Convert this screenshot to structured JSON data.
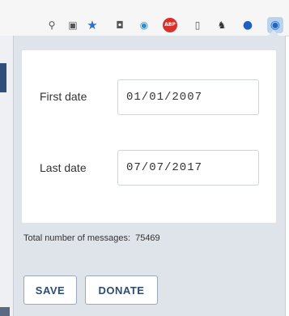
{
  "toolbar": {
    "icons": [
      {
        "name": "zoom-icon",
        "glyph": "⚲"
      },
      {
        "name": "translate-icon",
        "glyph": "▣"
      },
      {
        "name": "bookmark-star-icon",
        "glyph": "★"
      },
      {
        "name": "extension-robot-icon",
        "glyph": "◘"
      },
      {
        "name": "extension-arrow-icon",
        "glyph": "◉"
      },
      {
        "name": "adblock-plus-icon",
        "glyph": "ABP"
      },
      {
        "name": "document-icon",
        "glyph": "▯"
      },
      {
        "name": "evernote-icon",
        "glyph": "♞"
      },
      {
        "name": "chat-bubble-icon",
        "glyph": "●"
      },
      {
        "name": "active-extension-icon",
        "glyph": "◉"
      }
    ]
  },
  "form": {
    "first_date_label": "First date",
    "first_date_value": "01/01/2007",
    "last_date_label": "Last date",
    "last_date_value": "07/07/2017"
  },
  "stats": {
    "total_label": "Total number of messages:",
    "total_value": "75469"
  },
  "actions": {
    "save_label": "SAVE",
    "donate_label": "DONATE"
  },
  "colors": {
    "popup_bg": "#dfe3ea",
    "button_text": "#2d4b73",
    "star": "#2a6fd1",
    "adblock": "#d8312c"
  }
}
